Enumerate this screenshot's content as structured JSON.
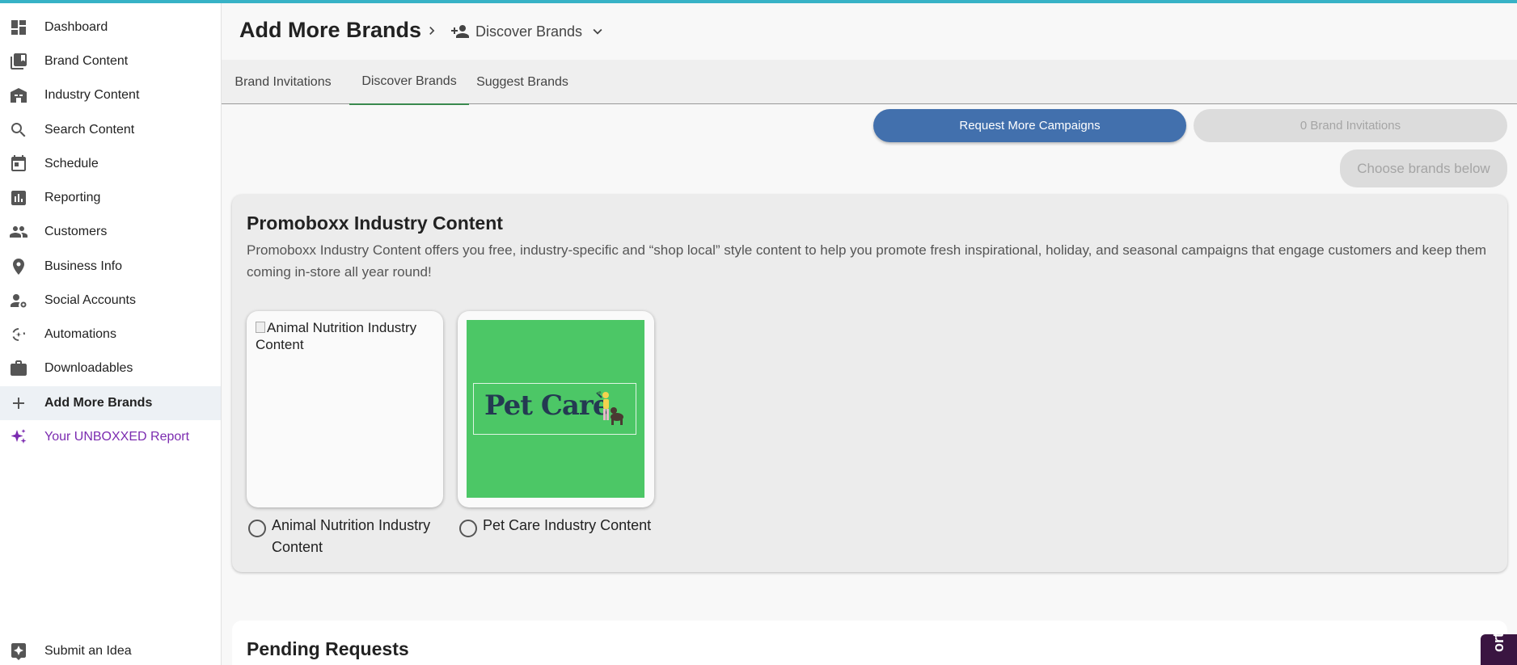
{
  "sidebar": {
    "items": [
      {
        "label": "Dashboard",
        "icon": "dashboard-icon"
      },
      {
        "label": "Brand Content",
        "icon": "library-icon"
      },
      {
        "label": "Industry Content",
        "icon": "store-icon"
      },
      {
        "label": "Search Content",
        "icon": "search-icon"
      },
      {
        "label": "Schedule",
        "icon": "calendar-icon"
      },
      {
        "label": "Reporting",
        "icon": "chart-icon"
      },
      {
        "label": "Customers",
        "icon": "people-icon"
      },
      {
        "label": "Business Info",
        "icon": "location-pin-icon"
      },
      {
        "label": "Social Accounts",
        "icon": "user-gear-icon"
      },
      {
        "label": "Automations",
        "icon": "automation-icon"
      },
      {
        "label": "Downloadables",
        "icon": "briefcase-icon"
      },
      {
        "label": "Add More Brands",
        "icon": "plus-icon"
      },
      {
        "label": "Your UNBOXXED Report",
        "icon": "sparkle-icon"
      }
    ],
    "footer": {
      "label": "Submit an Idea",
      "icon": "idea-star-icon"
    }
  },
  "header": {
    "title": "Add More Brands",
    "breadcrumb_current": "Discover Brands"
  },
  "tabs": [
    {
      "label": "Brand Invitations"
    },
    {
      "label": "Discover Brands"
    },
    {
      "label": "Suggest Brands"
    }
  ],
  "actions": {
    "request_label": "Request More Campaigns",
    "invitations_label": "0 Brand Invitations",
    "choose_label": "Choose brands below"
  },
  "industry": {
    "title": "Promoboxx Industry Content",
    "description": "Promoboxx Industry Content offers you free, industry-specific and “shop local” style content to help you promote fresh inspirational, holiday, and seasonal campaigns that engage customers and keep them coming in-store all year round!",
    "cards": [
      {
        "alt_text": "Animal Nutrition Industry Content",
        "label": "Animal Nutrition Industry Content"
      },
      {
        "image_text": "Pet Care",
        "label": "Pet Care Industry Content"
      }
    ]
  },
  "pending": {
    "title": "Pending Requests"
  },
  "support": {
    "label": "ort"
  },
  "colors": {
    "accent": "#37b2c6",
    "primary_button": "#4270ad",
    "active_tab": "#3a8a4e",
    "pet_card_bg": "#4cc766",
    "purple": "#7b2bb0"
  }
}
